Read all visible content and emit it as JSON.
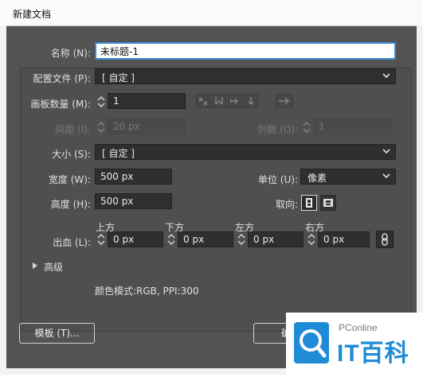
{
  "window": {
    "title": "新建文档"
  },
  "name": {
    "label": "名称 (N):",
    "value": "未标题-1"
  },
  "profile": {
    "label": "配置文件 (P):",
    "value": "[ 自定 ]"
  },
  "artboards": {
    "label": "画板数量 (M):",
    "value": "1"
  },
  "spacing": {
    "label": "间距 (I):",
    "value": "20 px"
  },
  "columns": {
    "label": "列数 (O):",
    "value": "1"
  },
  "size": {
    "label": "大小 (S):",
    "value": "[ 自定 ]"
  },
  "width": {
    "label": "宽度 (W):",
    "value": "500 px"
  },
  "units": {
    "label": "单位 (U):",
    "value": "像素"
  },
  "height": {
    "label": "高度 (H):",
    "value": "500 px"
  },
  "orientation": {
    "label": "取向:"
  },
  "bleed": {
    "label": "出血 (L):",
    "top": {
      "label": "上方",
      "value": "0 px"
    },
    "bottom": {
      "label": "下方",
      "value": "0 px"
    },
    "left": {
      "label": "左方",
      "value": "0 px"
    },
    "right": {
      "label": "右方",
      "value": "0 px"
    }
  },
  "advanced": {
    "label": "高级"
  },
  "color_mode": {
    "text": "颜色模式:RGB, PPI:300"
  },
  "buttons": {
    "templates": "模板 (T)...",
    "create": "确"
  },
  "watermark": {
    "brand_small": "PConline",
    "brand_big": "IT百科"
  },
  "colors": {
    "dialog_bg": "#535353",
    "field_bg": "#2f2f2f",
    "focus_border": "#3a88d8",
    "brand_blue": "#1f8bd6"
  },
  "icons": [
    "spinner-arrows-icon",
    "chevron-down-icon",
    "arrange-grid-icon",
    "arrange-row-icon",
    "arrange-column-icon",
    "arrange-down-icon",
    "arrow-right-icon",
    "portrait-icon",
    "landscape-icon",
    "link-icon",
    "disclosure-triangle-icon"
  ]
}
